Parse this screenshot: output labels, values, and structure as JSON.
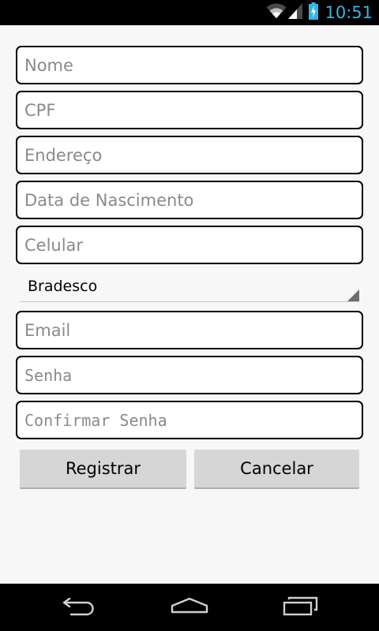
{
  "status_bar": {
    "time": "10:51",
    "icons": [
      "wifi-icon",
      "signal-icon",
      "battery-charging-icon"
    ],
    "accent_color": "#33b5e5"
  },
  "form": {
    "nome": {
      "placeholder": "Nome",
      "value": ""
    },
    "cpf": {
      "placeholder": "CPF",
      "value": ""
    },
    "endereco": {
      "placeholder": "Endereço",
      "value": ""
    },
    "data_nascimento": {
      "placeholder": "Data de Nascimento",
      "value": ""
    },
    "celular": {
      "placeholder": "Celular",
      "value": ""
    },
    "banco": {
      "selected": "Bradesco"
    },
    "email": {
      "placeholder": "Email",
      "value": ""
    },
    "senha": {
      "placeholder": "Senha",
      "value": ""
    },
    "confirmar_senha": {
      "placeholder": "Confirmar Senha",
      "value": ""
    }
  },
  "buttons": {
    "register_label": "Registrar",
    "cancel_label": "Cancelar"
  },
  "nav_bar": {
    "icons": [
      "back-icon",
      "home-icon",
      "recent-apps-icon"
    ]
  }
}
